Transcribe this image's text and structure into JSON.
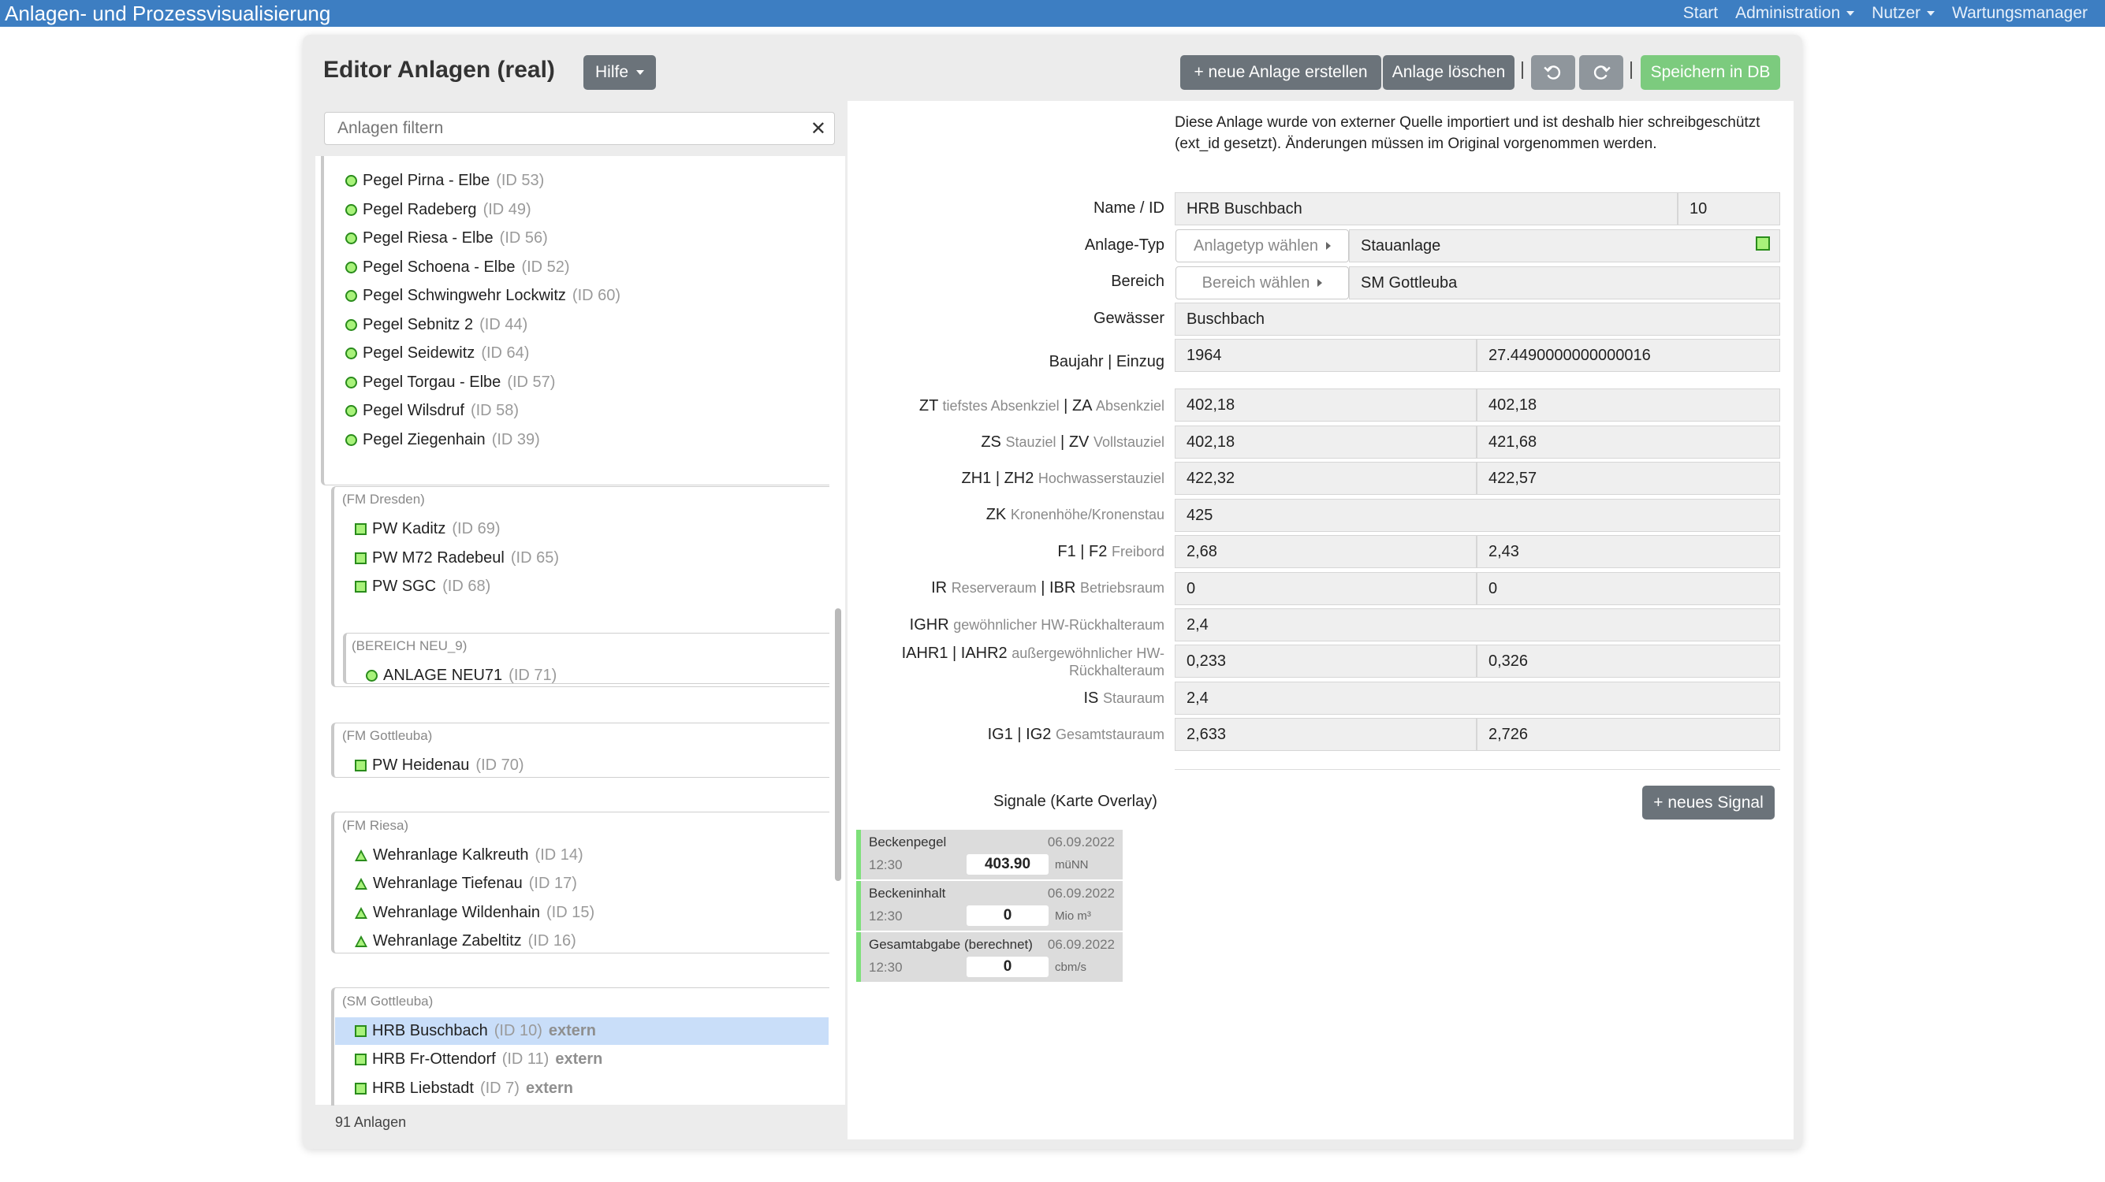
{
  "nav": {
    "brand": "Anlagen- und Prozessvisualisierung",
    "items": [
      "Start",
      "Administration",
      "Nutzer",
      "Wartungsmanager"
    ]
  },
  "header": {
    "title": "Editor Anlagen (real)",
    "help": "Hilfe",
    "new_label": "+ neue Anlage erstellen",
    "delete_label": "Anlage löschen",
    "save_label": "Speichern in DB"
  },
  "filter": {
    "placeholder": "Anlagen filtern"
  },
  "tree": {
    "count_label": "91 Anlagen",
    "top_items": [
      {
        "name": "Pegel Pirna - Elbe",
        "id": "(ID 53)"
      },
      {
        "name": "Pegel Radeberg",
        "id": "(ID 49)"
      },
      {
        "name": "Pegel Riesa - Elbe",
        "id": "(ID 56)"
      },
      {
        "name": "Pegel Schoena - Elbe",
        "id": "(ID 52)"
      },
      {
        "name": "Pegel Schwingwehr Lockwitz",
        "id": "(ID 60)"
      },
      {
        "name": "Pegel Sebnitz 2",
        "id": "(ID 44)"
      },
      {
        "name": "Pegel Seidewitz",
        "id": "(ID 64)"
      },
      {
        "name": "Pegel Torgau - Elbe",
        "id": "(ID 57)"
      },
      {
        "name": "Pegel Wilsdruf",
        "id": "(ID 58)"
      },
      {
        "name": "Pegel Ziegenhain",
        "id": "(ID 39)"
      }
    ],
    "groups": {
      "dresden": {
        "label": "(FM Dresden)",
        "items": [
          {
            "name": "PW Kaditz",
            "id": "(ID 69)"
          },
          {
            "name": "PW M72 Radebeul",
            "id": "(ID 65)"
          },
          {
            "name": "PW SGC",
            "id": "(ID 68)"
          }
        ],
        "sub": {
          "label": "(BEREICH NEU_9)",
          "items": [
            {
              "name": "ANLAGE NEU71",
              "id": "(ID 71)"
            }
          ]
        }
      },
      "gottleuba_fm": {
        "label": "(FM Gottleuba)",
        "items": [
          {
            "name": "PW Heidenau",
            "id": "(ID 70)"
          }
        ]
      },
      "riesa": {
        "label": "(FM Riesa)",
        "items": [
          {
            "name": "Wehranlage Kalkreuth",
            "id": "(ID 14)"
          },
          {
            "name": "Wehranlage Tiefenau",
            "id": "(ID 17)"
          },
          {
            "name": "Wehranlage Wildenhain",
            "id": "(ID 15)"
          },
          {
            "name": "Wehranlage Zabeltitz",
            "id": "(ID 16)"
          }
        ]
      },
      "gottleuba_sm": {
        "label": "(SM Gottleuba)",
        "items": [
          {
            "name": "HRB Buschbach",
            "id": "(ID 10)",
            "tag": "extern"
          },
          {
            "name": "HRB Fr-Ottendorf",
            "id": "(ID 11)",
            "tag": "extern"
          },
          {
            "name": "HRB Liebstadt",
            "id": "(ID 7)",
            "tag": "extern"
          }
        ]
      }
    }
  },
  "detail": {
    "info": "Diese Anlage wurde von externer Quelle importiert und ist deshalb hier schreibgeschützt (ext_id gesetzt). Änderungen müssen im Original vorgenommen werden.",
    "name_label": "Name / ID",
    "name": "HRB Buschbach",
    "id": "10",
    "type_label": "Anlage-Typ",
    "type_btn": "Anlagetyp wählen",
    "type_value": "Stauanlage",
    "area_label": "Bereich",
    "area_btn": "Bereich wählen",
    "area_value": "SM Gottleuba",
    "water_label": "Gewässer",
    "water_value": "Buschbach",
    "year_label": "Baujahr | Einzug",
    "year": "1964",
    "catchment": "27.4490000000000016",
    "zt_za": {
      "a": "ZT",
      "a_sub": "tiefstes Absenkziel",
      "b": "ZA",
      "b_sub": "Absenkziel",
      "v1": "402,18",
      "v2": "402,18"
    },
    "zs_zv": {
      "a": "ZS",
      "a_sub": "Stauziel",
      "b": "ZV",
      "b_sub": "Vollstauziel",
      "v1": "402,18",
      "v2": "421,68"
    },
    "zh": {
      "a": "ZH1 | ZH2",
      "sub": "Hochwasserstauziel",
      "v1": "422,32",
      "v2": "422,57"
    },
    "zk": {
      "a": "ZK",
      "sub": "Kronenhöhe/Kronenstau",
      "v1": "425"
    },
    "f": {
      "a": "F1 | F2",
      "sub": "Freibord",
      "v1": "2,68",
      "v2": "2,43"
    },
    "ir": {
      "a": "IR",
      "a_sub": "Reserveraum",
      "b": "IBR",
      "b_sub": "Betriebsraum",
      "v1": "0",
      "v2": "0"
    },
    "ighr": {
      "a": "IGHR",
      "sub": "gewöhnlicher HW-Rückhalteraum",
      "v1": "2,4"
    },
    "iahr": {
      "a": "IAHR1 | IAHR2",
      "sub1": "außergewöhnlicher HW-",
      "sub2": "Rückhalteraum",
      "v1": "0,233",
      "v2": "0,326"
    },
    "is": {
      "a": "IS",
      "sub": "Stauraum",
      "v1": "2,4"
    },
    "ig": {
      "a": "IG1 | IG2",
      "sub": "Gesamtstauraum",
      "v1": "2,633",
      "v2": "2,726"
    }
  },
  "signals": {
    "title": "Signale (Karte Overlay)",
    "new_label": "+ neues Signal",
    "items": [
      {
        "name": "Beckenpegel",
        "date": "06.09.2022",
        "time": "12:30",
        "value": "403.90",
        "unit": "müNN"
      },
      {
        "name": "Beckeninhalt",
        "date": "06.09.2022",
        "time": "12:30",
        "value": "0",
        "unit": "Mio m³"
      },
      {
        "name": "Gesamtabgabe (berechnet)",
        "date": "06.09.2022",
        "time": "12:30",
        "value": "0",
        "unit": "cbm/s"
      }
    ]
  }
}
